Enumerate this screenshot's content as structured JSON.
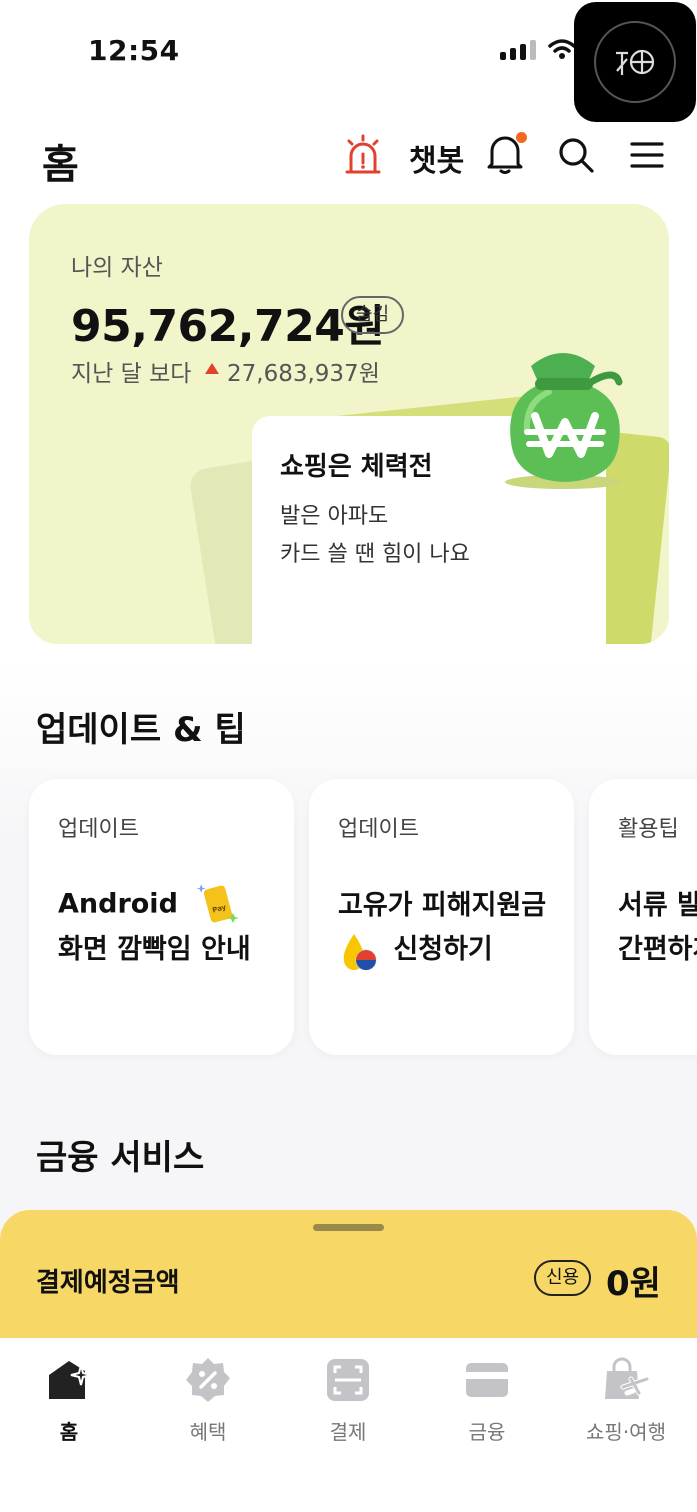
{
  "status_bar": {
    "time": "12:54"
  },
  "header": {
    "title": "홈",
    "chatbot_label": "챗봇"
  },
  "asset_card": {
    "label": "나의 자산",
    "amount": "95,762,724원",
    "hide_label": "숨김",
    "compare_label": "지난 달 보다",
    "compare_value": "27,683,937원",
    "promo": {
      "title": "쇼핑은 체력전",
      "line1": "발은 아파도",
      "line2": "카드 쓸 땐 힘이 나요"
    }
  },
  "updates": {
    "title": "업데이트 & 팁",
    "cards": [
      {
        "category": "업데이트",
        "line1": "Android",
        "line2": "화면 깜빡임 안내"
      },
      {
        "category": "업데이트",
        "line1": "고유가 피해지원금",
        "line2": "신청하기"
      },
      {
        "category": "활용팁",
        "line1": "서류 발급",
        "line2": "간편하게"
      }
    ]
  },
  "finance": {
    "title": "금융 서비스"
  },
  "payment": {
    "label": "결제예정금액",
    "badge": "신용",
    "amount": "0원"
  },
  "tabs": [
    {
      "label": "홈",
      "icon": "home-icon"
    },
    {
      "label": "혜택",
      "icon": "benefit-icon"
    },
    {
      "label": "결제",
      "icon": "scan-pay-icon"
    },
    {
      "label": "금융",
      "icon": "card-icon"
    },
    {
      "label": "쇼핑·여행",
      "icon": "shopping-travel-icon"
    }
  ],
  "colors": {
    "accent_yellow": "#f7d765",
    "card_green": "#f1f5c9",
    "alert_red": "#e0422f",
    "notification_orange": "#f06b1e"
  }
}
